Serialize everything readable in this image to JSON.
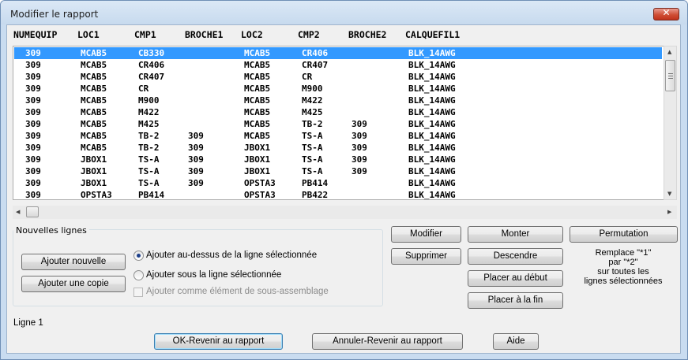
{
  "window": {
    "title": "Modifier le rapport",
    "close_glyph": "✕"
  },
  "columns": [
    "NUMEQUIP",
    "LOC1",
    "CMP1",
    "BROCHE1",
    "LOC2",
    "CMP2",
    "BROCHE2",
    "CALQUEFIL1"
  ],
  "rows": [
    [
      "309",
      "MCAB5",
      "CB330",
      "",
      "MCAB5",
      "CR406",
      "",
      "BLK_14AWG"
    ],
    [
      "309",
      "MCAB5",
      "CR406",
      "",
      "MCAB5",
      "CR407",
      "",
      "BLK_14AWG"
    ],
    [
      "309",
      "MCAB5",
      "CR407",
      "",
      "MCAB5",
      "CR",
      "",
      "BLK_14AWG"
    ],
    [
      "309",
      "MCAB5",
      "CR",
      "",
      "MCAB5",
      "M900",
      "",
      "BLK_14AWG"
    ],
    [
      "309",
      "MCAB5",
      "M900",
      "",
      "MCAB5",
      "M422",
      "",
      "BLK_14AWG"
    ],
    [
      "309",
      "MCAB5",
      "M422",
      "",
      "MCAB5",
      "M425",
      "",
      "BLK_14AWG"
    ],
    [
      "309",
      "MCAB5",
      "M425",
      "",
      "MCAB5",
      "TB-2",
      "309",
      "BLK_14AWG"
    ],
    [
      "309",
      "MCAB5",
      "TB-2",
      "309",
      "MCAB5",
      "TS-A",
      "309",
      "BLK_14AWG"
    ],
    [
      "309",
      "MCAB5",
      "TB-2",
      "309",
      "JBOX1",
      "TS-A",
      "309",
      "BLK_14AWG"
    ],
    [
      "309",
      "JBOX1",
      "TS-A",
      "309",
      "JBOX1",
      "TS-A",
      "309",
      "BLK_14AWG"
    ],
    [
      "309",
      "JBOX1",
      "TS-A",
      "309",
      "JBOX1",
      "TS-A",
      "309",
      "BLK_14AWG"
    ],
    [
      "309",
      "JBOX1",
      "TS-A",
      "309",
      "OPSTA3",
      "PB414",
      "",
      "BLK_14AWG"
    ],
    [
      "309",
      "OPSTA3",
      "PB414",
      "",
      "OPSTA3",
      "PB422",
      "",
      "BLK_14AWG"
    ]
  ],
  "selected_row_index": 0,
  "scrollbars": {
    "up_arrow": "▲",
    "down_arrow": "▼",
    "left_arrow": "◀",
    "right_arrow": "▶"
  },
  "nouvelles_lignes": {
    "label": "Nouvelles lignes",
    "add_new": "Ajouter nouvelle",
    "add_copy": "Ajouter une copie",
    "radio_above": "Ajouter au-dessus de la ligne sélectionnée",
    "radio_below": "Ajouter sous la ligne sélectionnée",
    "checkbox_sub": "Ajouter comme élément de sous-assemblage",
    "selected_option": "above",
    "checkbox_checked": false
  },
  "actions": {
    "modifier": "Modifier",
    "supprimer": "Supprimer",
    "monter": "Monter",
    "descendre": "Descendre",
    "placer_debut": "Placer au début",
    "placer_fin": "Placer à la fin",
    "permutation": "Permutation"
  },
  "permutation_note": [
    "Remplace \"*1\"",
    "par \"*2\"",
    "sur toutes les",
    "lignes sélectionnées"
  ],
  "status": "Ligne 1",
  "footer": {
    "ok": "OK-Revenir au rapport",
    "cancel": "Annuler-Revenir au rapport",
    "help": "Aide"
  },
  "colors": {
    "selection": "#3399ff",
    "window_frame": "#c9dcf0",
    "dialog_bg": "#f0f0f0",
    "close_button": "#c7422a",
    "radio_dot": "#1c3f8a"
  }
}
